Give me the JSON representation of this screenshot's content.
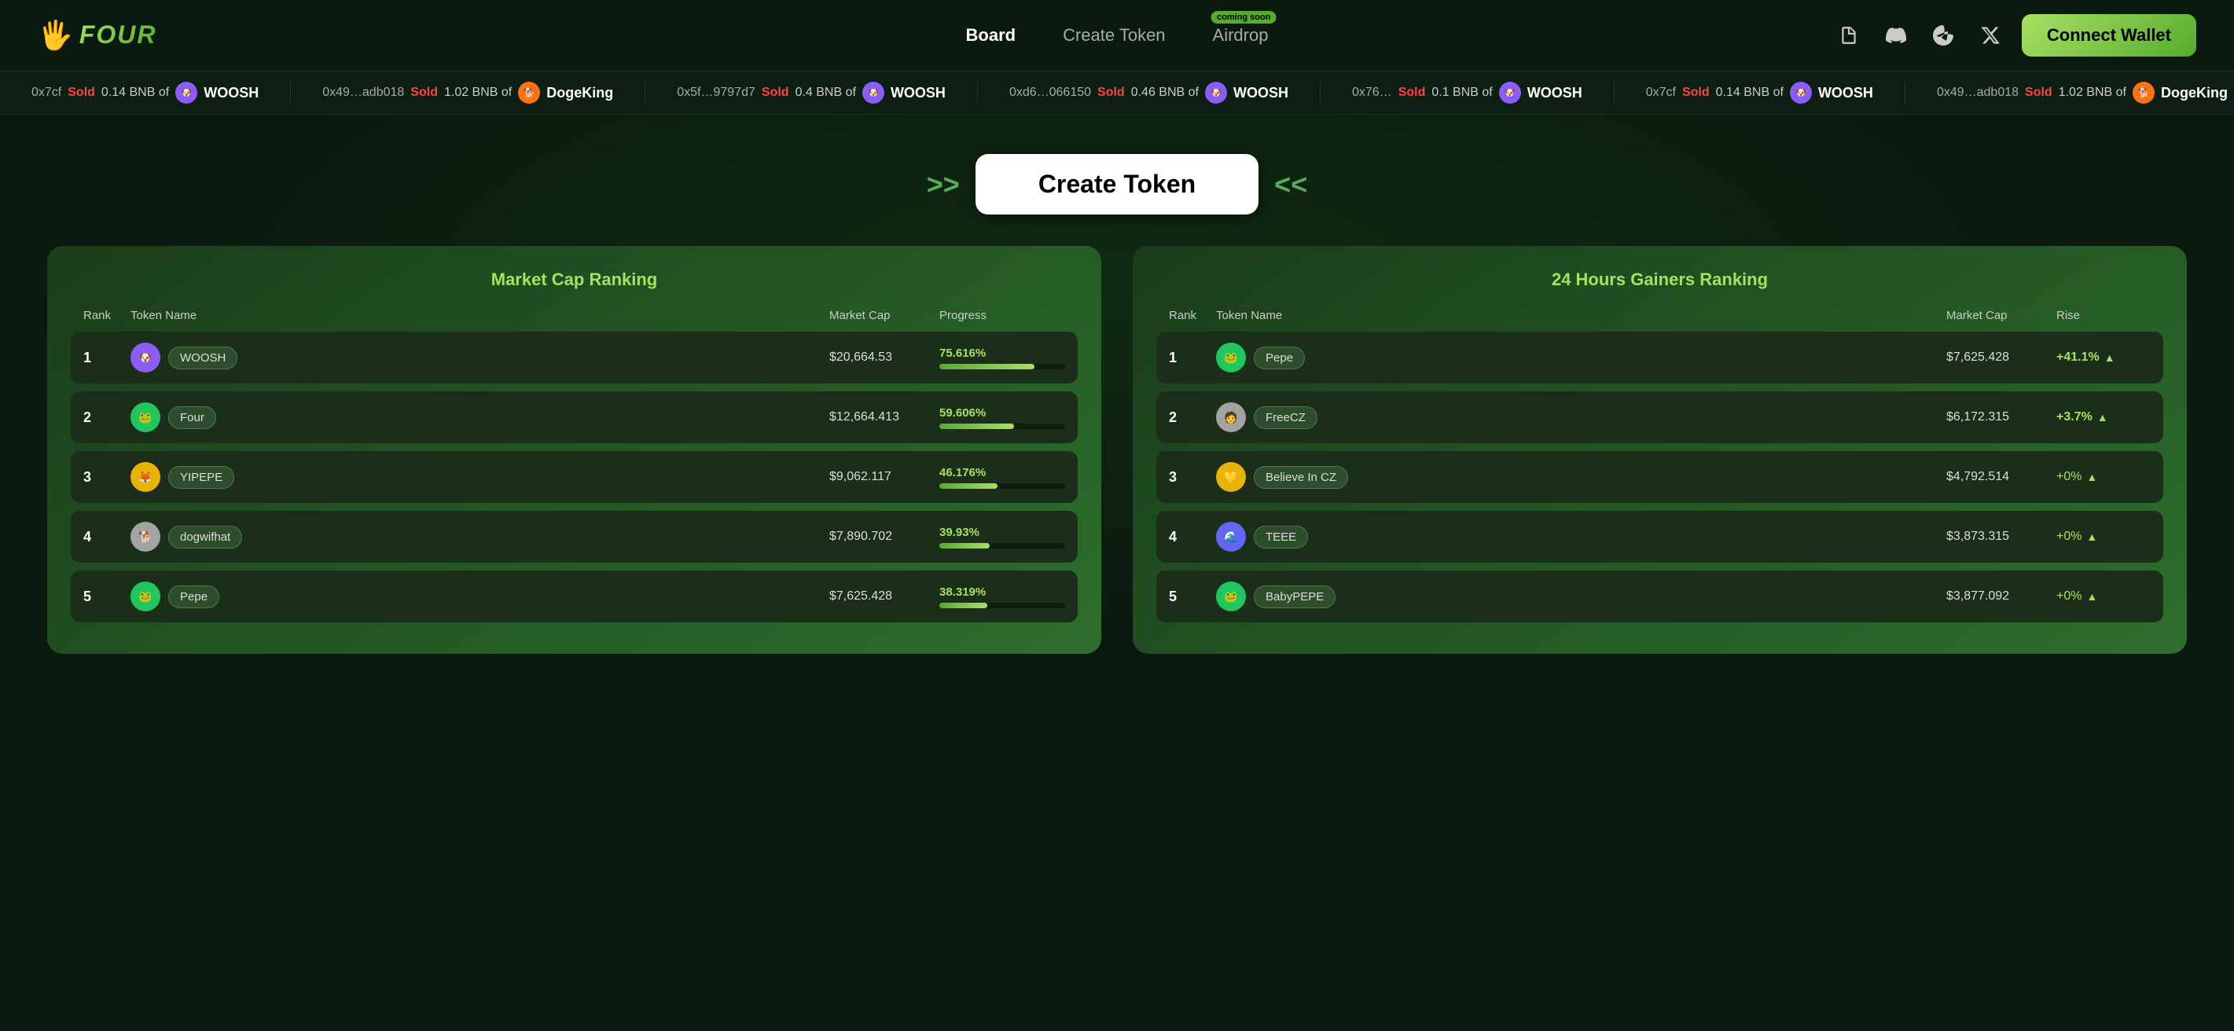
{
  "navbar": {
    "logo_hand": "🖐",
    "logo_text": "FOUR",
    "links": [
      {
        "label": "Board",
        "id": "board",
        "active": true
      },
      {
        "label": "Create Token",
        "id": "create-token",
        "active": false
      },
      {
        "label": "Airdrop",
        "id": "airdrop",
        "active": false,
        "badge": "coming soon"
      }
    ],
    "icons": [
      {
        "name": "docs-icon",
        "symbol": "📄"
      },
      {
        "name": "discord-icon",
        "symbol": "💬"
      },
      {
        "name": "telegram-icon",
        "symbol": "✈"
      },
      {
        "name": "twitter-icon",
        "symbol": "𝕏"
      }
    ],
    "connect_wallet_label": "Connect Wallet"
  },
  "ticker": {
    "items": [
      {
        "address": "0x7cf",
        "action": "Sold",
        "amount": "0.14 BNB of",
        "token": "WOOSH"
      },
      {
        "address": "0x49…adb018",
        "action": "Sold",
        "amount": "1.02 BNB of",
        "token": "DogeKing"
      },
      {
        "address": "0x5f…9797d7",
        "action": "Sold",
        "amount": "0.4 BNB of",
        "token": "WOOSH"
      },
      {
        "address": "0xd6…066150",
        "action": "Sold",
        "amount": "0.46 BNB of",
        "token": "WOOSH"
      },
      {
        "address": "0x76…",
        "action": "Sold",
        "amount": "0.1 BNB of",
        "token": "WOOSH"
      }
    ]
  },
  "create_token_section": {
    "chevron_left": ">>",
    "chevron_right": "<<",
    "button_label": "Create Token"
  },
  "market_cap_ranking": {
    "title": "Market Cap Ranking",
    "headers": [
      "Rank",
      "Token Name",
      "Market Cap",
      "Progress"
    ],
    "rows": [
      {
        "rank": 1,
        "token": "WOOSH",
        "market_cap": "$20,664.53",
        "progress": "75.616%",
        "progress_pct": 75.616
      },
      {
        "rank": 2,
        "token": "Four",
        "market_cap": "$12,664.413",
        "progress": "59.606%",
        "progress_pct": 59.606
      },
      {
        "rank": 3,
        "token": "YIPEPE",
        "market_cap": "$9,062.117",
        "progress": "46.176%",
        "progress_pct": 46.176
      },
      {
        "rank": 4,
        "token": "dogwifhat",
        "market_cap": "$7,890.702",
        "progress": "39.93%",
        "progress_pct": 39.93
      },
      {
        "rank": 5,
        "token": "Pepe",
        "market_cap": "$7,625.428",
        "progress": "38.319%",
        "progress_pct": 38.319
      }
    ]
  },
  "gainers_ranking": {
    "title": "24 Hours Gainers Ranking",
    "headers": [
      "Rank",
      "Token Name",
      "Market Cap",
      "Rise"
    ],
    "rows": [
      {
        "rank": 1,
        "token": "Pepe",
        "market_cap": "$7,625.428",
        "rise": "+41.1%",
        "rise_type": "positive"
      },
      {
        "rank": 2,
        "token": "FreeCZ",
        "market_cap": "$6,172.315",
        "rise": "+3.7%",
        "rise_type": "positive"
      },
      {
        "rank": 3,
        "token": "Believe In CZ",
        "market_cap": "$4,792.514",
        "rise": "+0%",
        "rise_type": "zero"
      },
      {
        "rank": 4,
        "token": "TEEE",
        "market_cap": "$3,873.315",
        "rise": "+0%",
        "rise_type": "zero"
      },
      {
        "rank": 5,
        "token": "BabyPEPE",
        "market_cap": "$3,877.092",
        "rise": "+0%",
        "rise_type": "zero"
      }
    ]
  },
  "token_colors": {
    "WOOSH": "#8B5CF6",
    "Four": "#22c55e",
    "YIPEPE": "#eab308",
    "dogwifhat": "#a3a3a3",
    "Pepe": "#22c55e",
    "FreeCZ": "#a3a3a3",
    "Believe In CZ": "#eab308",
    "TEEE": "#6366f1",
    "BabyPEPE": "#22c55e",
    "DogeKing": "#f97316"
  }
}
